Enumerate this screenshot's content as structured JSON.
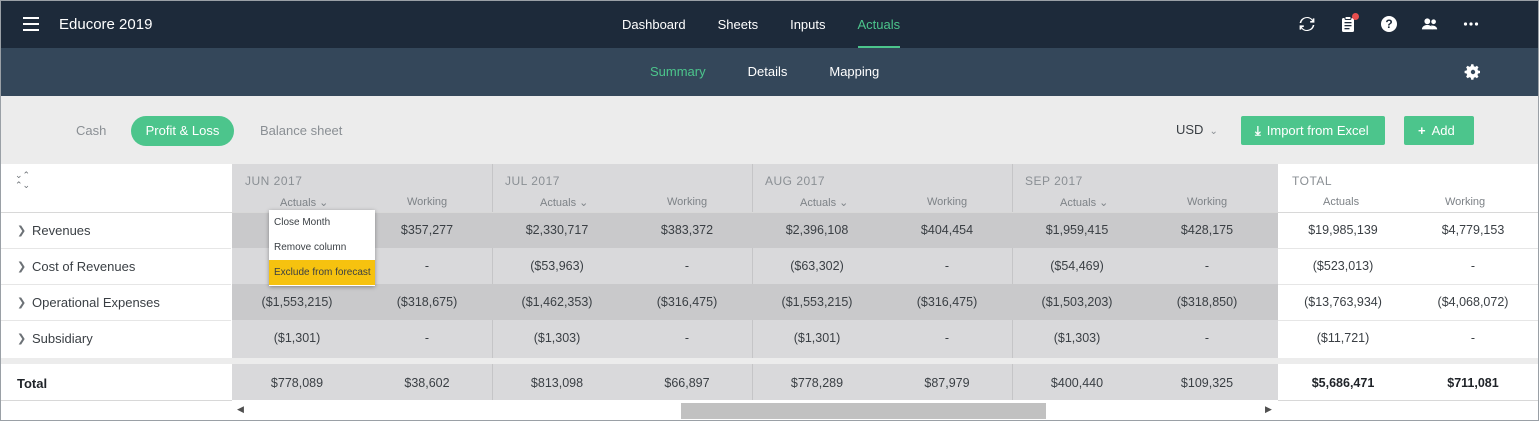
{
  "app": {
    "title": "Educore 2019"
  },
  "top_nav": [
    {
      "label": "Dashboard",
      "active": false
    },
    {
      "label": "Sheets",
      "active": false
    },
    {
      "label": "Inputs",
      "active": false
    },
    {
      "label": "Actuals",
      "active": true
    }
  ],
  "top_icons": [
    "refresh-icon",
    "clipboard-icon",
    "help-icon",
    "people-icon",
    "more-icon"
  ],
  "sub_nav": [
    {
      "label": "Summary",
      "active": true
    },
    {
      "label": "Details",
      "active": false
    },
    {
      "label": "Mapping",
      "active": false
    }
  ],
  "report_tabs": {
    "cash": "Cash",
    "pl": "Profit & Loss",
    "bs": "Balance sheet"
  },
  "currency": "USD",
  "buttons": {
    "import": "Import from Excel",
    "add": "Add"
  },
  "months": [
    "JUN 2017",
    "JUL 2017",
    "AUG 2017",
    "SEP 2017"
  ],
  "total_label": "TOTAL",
  "col_types": {
    "actuals": "Actuals",
    "working": "Working"
  },
  "rows": [
    {
      "label": "Revenues",
      "values": [
        "",
        "$357,277",
        "$2,330,717",
        "$383,372",
        "$2,396,108",
        "$404,454",
        "$1,959,415",
        "$428,175",
        "$19,985,139",
        "$4,779,153"
      ]
    },
    {
      "label": "Cost of Revenues",
      "values": [
        "",
        "-",
        "($53,963)",
        "-",
        "($63,302)",
        "-",
        "($54,469)",
        "-",
        "($523,013)",
        "-"
      ]
    },
    {
      "label": "Operational Expenses",
      "values": [
        "($1,553,215)",
        "($318,675)",
        "($1,462,353)",
        "($316,475)",
        "($1,553,215)",
        "($316,475)",
        "($1,503,203)",
        "($318,850)",
        "($13,763,934)",
        "($4,068,072)"
      ]
    },
    {
      "label": "Subsidiary",
      "values": [
        "($1,301)",
        "-",
        "($1,303)",
        "-",
        "($1,301)",
        "-",
        "($1,303)",
        "-",
        "($11,721)",
        "-"
      ]
    }
  ],
  "total_row": {
    "label": "Total",
    "values": [
      "$778,089",
      "$38,602",
      "$813,098",
      "$66,897",
      "$778,289",
      "$87,979",
      "$400,440",
      "$109,325",
      "$5,686,471",
      "$711,081"
    ]
  },
  "context_menu": [
    {
      "label": "Close Month",
      "highlighted": false
    },
    {
      "label": "Remove column",
      "highlighted": false
    },
    {
      "label": "Exclude from forecast",
      "highlighted": true
    }
  ],
  "colors": {
    "brand_green": "#4cc58c",
    "topbar": "#1d2a3a",
    "subbar": "#34475a",
    "highlight": "#f6c20f"
  }
}
